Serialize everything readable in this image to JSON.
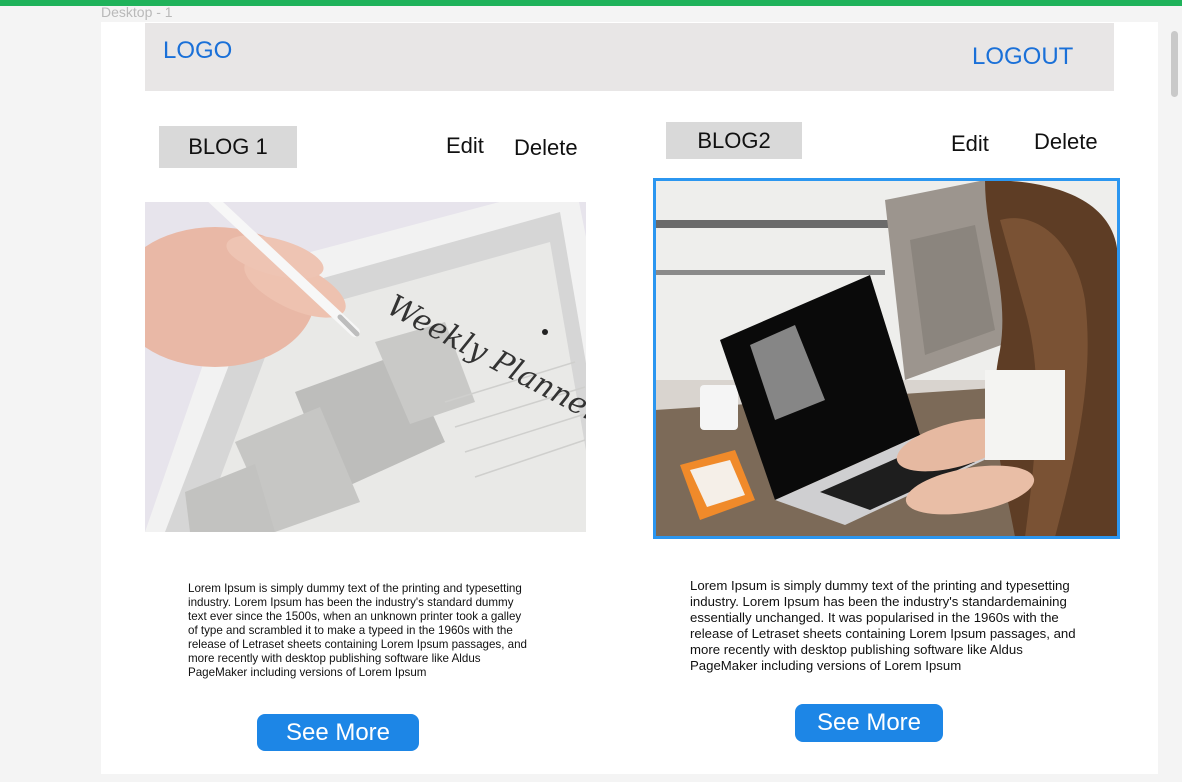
{
  "frame_label": "Desktop - 1",
  "header": {
    "logo": "LOGO",
    "logout": "LOGOUT"
  },
  "blogs": [
    {
      "title": "BLOG 1",
      "edit": "Edit",
      "delete": "Delete",
      "image": "Weekly planner on tablet with stylus",
      "planner_heading": "Weekly Planner",
      "description": "Lorem Ipsum is simply dummy text of the printing and typesetting industry. Lorem Ipsum has been the industry's standard dummy text ever since the 1500s, when an unknown printer took a galley of type and scrambled it to make a typeed in the 1960s with the release of Letraset sheets containing Lorem Ipsum passages, and more recently with desktop publishing software like Aldus PageMaker including versions of Lorem Ipsum",
      "see_more": "See More"
    },
    {
      "title": "BLOG2",
      "edit": "Edit",
      "delete": "Delete",
      "image": "Woman working on laptop at desk",
      "description": "Lorem Ipsum is simply dummy text of the printing and typesetting industry. Lorem Ipsum has been the industry's standardemaining essentially unchanged. It was popularised in the 1960s with the release of Letraset sheets containing Lorem Ipsum passages, and more recently with desktop publishing software like Aldus PageMaker including versions of Lorem Ipsum",
      "see_more": "See More"
    }
  ],
  "colors": {
    "accent": "#1d86e6",
    "link": "#1a70d8",
    "header_bg": "#e8e6e6",
    "selection": "#2b96f0"
  }
}
